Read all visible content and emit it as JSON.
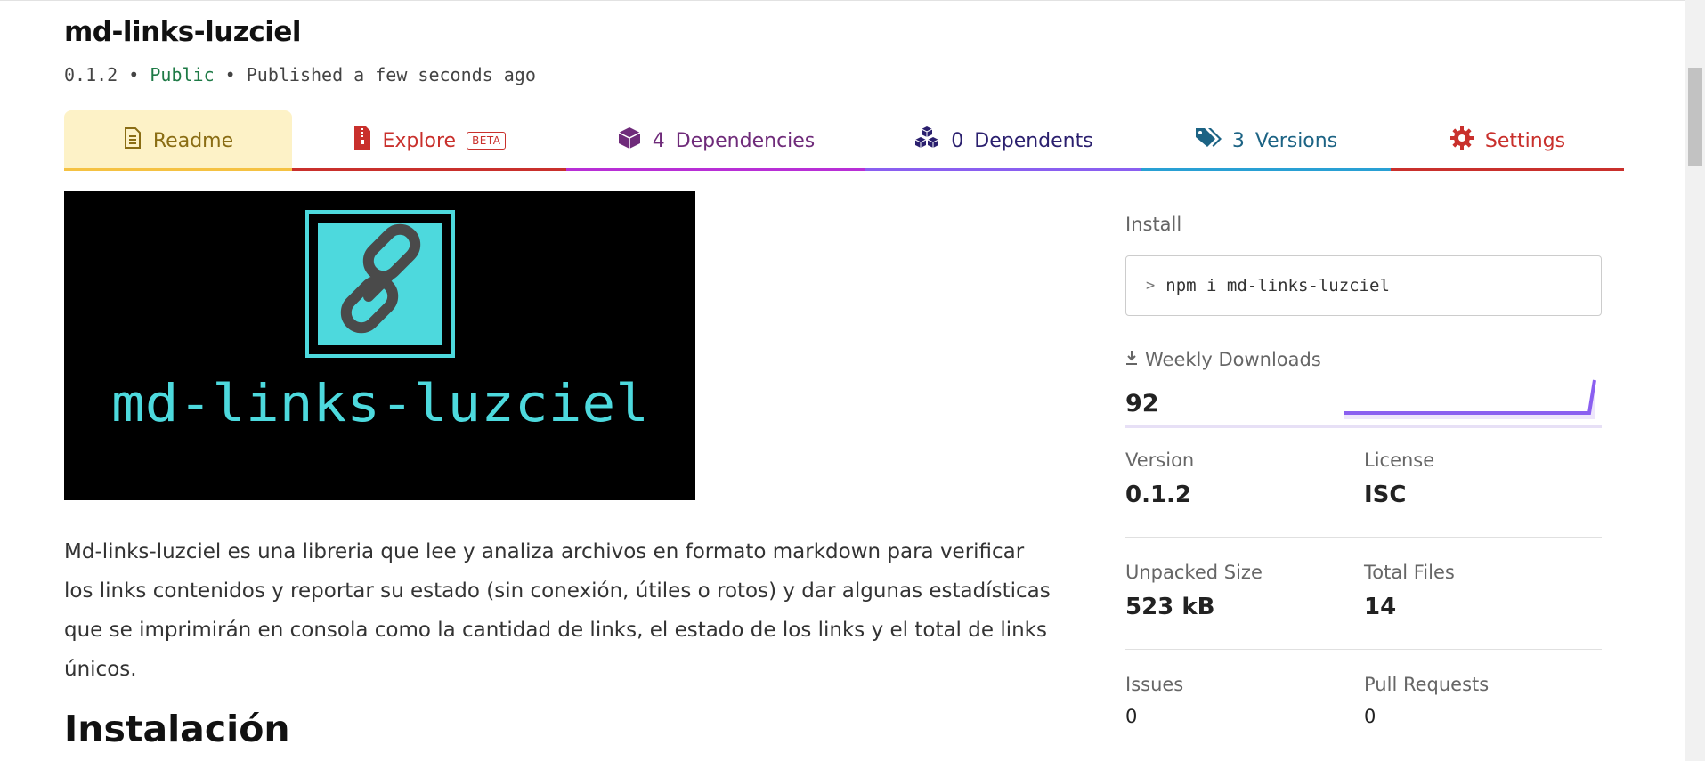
{
  "package": {
    "title": "md-links-luzciel",
    "version": "0.1.2",
    "separator": "•",
    "visibility": "Public",
    "published": "Published a few seconds ago"
  },
  "tabs": {
    "readme": {
      "label": "Readme",
      "icon": "document-icon"
    },
    "explore": {
      "label": "Explore",
      "badge": "BETA",
      "icon": "zip-file-icon"
    },
    "dependencies": {
      "count": "4",
      "label": "Dependencies",
      "icon": "cube-icon"
    },
    "dependents": {
      "count": "0",
      "label": "Dependents",
      "icon": "cubes-icon"
    },
    "versions": {
      "count": "3",
      "label": "Versions",
      "icon": "tags-icon"
    },
    "settings": {
      "label": "Settings",
      "icon": "gear-icon"
    }
  },
  "banner": {
    "text": "md-links-luzciel",
    "icon": "chain-link-icon"
  },
  "readme": {
    "paragraph": "Md-links-luzciel es una libreria que lee y analiza archivos en formato markdown para verificar los links contenidos y reportar su estado (sin conexión, útiles o rotos) y dar algunas estadísticas que se imprimirán en consola como la cantidad de links, el estado de los links y el total de links únicos.",
    "heading": "Instalación"
  },
  "sidebar": {
    "install_label": "Install",
    "install_command": "npm i md-links-luzciel",
    "weekly_downloads_label": "Weekly Downloads",
    "weekly_downloads_value": "92",
    "version_label": "Version",
    "version_value": "0.1.2",
    "license_label": "License",
    "license_value": "ISC",
    "unpacked_size_label": "Unpacked Size",
    "unpacked_size_value": "523 kB",
    "total_files_label": "Total Files",
    "total_files_value": "14",
    "issues_label": "Issues",
    "issues_value": "0",
    "pull_requests_label": "Pull Requests",
    "pull_requests_value": "0"
  },
  "colors": {
    "public": "#1e7a46",
    "readme_tab": "#f5c242",
    "explore_tab": "#c9302c",
    "dependencies_tab": "#b82fd6",
    "dependents_tab": "#8a5ff0",
    "versions_tab": "#29a0d4",
    "settings_tab": "#c9302c",
    "sparkline": "#8a5ff0",
    "banner_accent": "#4dd9dd"
  }
}
